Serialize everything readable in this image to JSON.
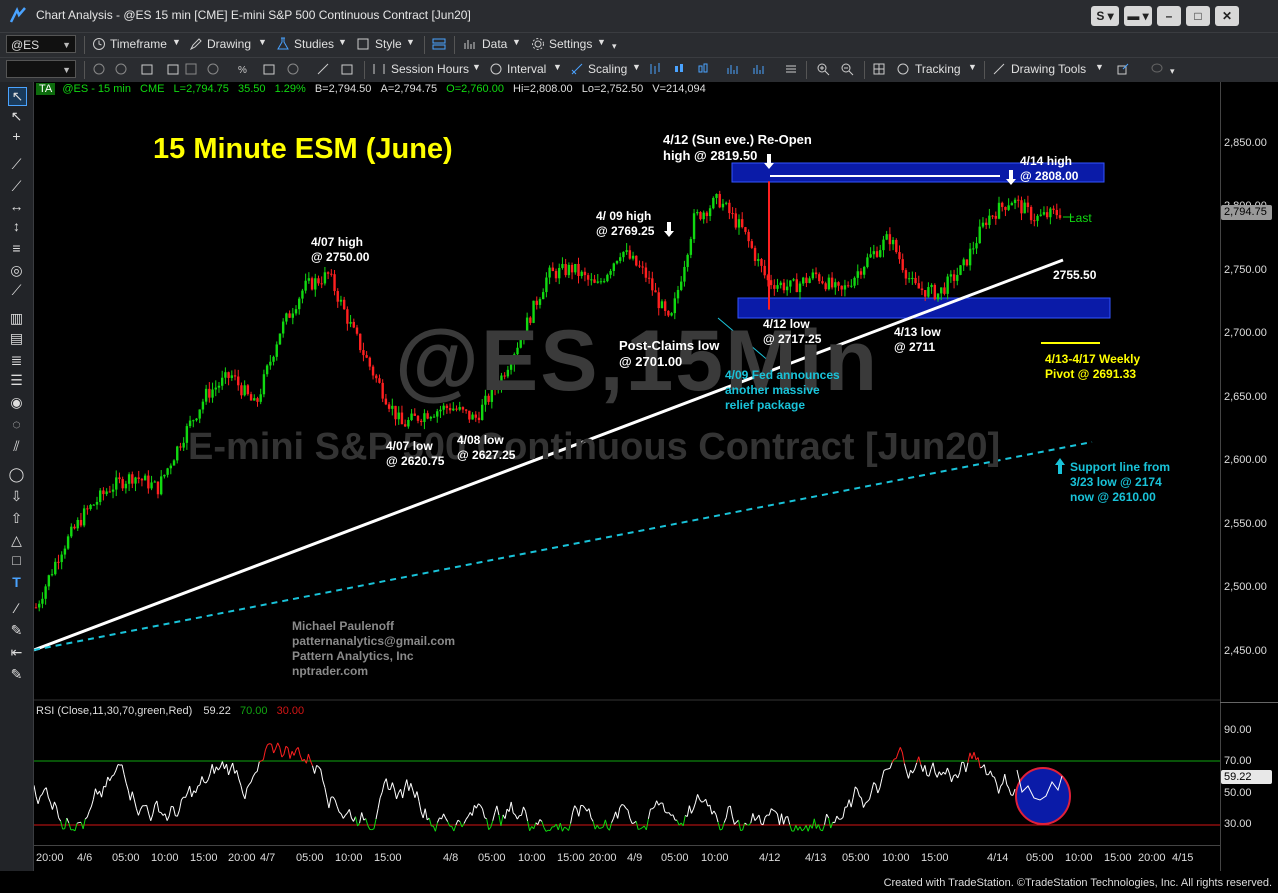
{
  "window": {
    "title": "Chart Analysis - @ES 15 min [CME] E-mini S&P 500 Continuous Contract [Jun20]",
    "btn_s": "S",
    "btn_min": "–",
    "btn_max": "□",
    "btn_close": "✕"
  },
  "toolbar1": {
    "symbol": "@ES",
    "timeframe": "Timeframe",
    "drawing": "Drawing",
    "studies": "Studies",
    "style": "Style",
    "data": "Data",
    "settings": "Settings"
  },
  "toolbar2": {
    "session_hours": "Session Hours",
    "interval": "Interval",
    "scaling": "Scaling",
    "tracking": "Tracking",
    "drawing_tools": "Drawing Tools"
  },
  "legend": {
    "ta": "TA",
    "symbol": "@ES - 15 min",
    "exchange": "CME",
    "last": "L=2,794.75",
    "change": "35.50",
    "pct": "1.29%",
    "bid": "B=2,794.50",
    "ask": "A=2,794.75",
    "open": "O=2,760.00",
    "high": "Hi=2,808.00",
    "low": "Lo=2,752.50",
    "volume": "V=214,094"
  },
  "watermark": {
    "symbol": "@ES,15Min",
    "name": "E-mini S&P 500 Continuous Contract [Jun20]"
  },
  "annotations": {
    "title": "15 Minute ESM (June)",
    "h0407_a": "4/07 high",
    "h0407_b": "@ 2750.00",
    "l0407_a": "4/07 low",
    "l0407_b": "@ 2620.75",
    "l0408_a": "4/08 low",
    "l0408_b": "@ 2627.25",
    "h0409_a": "4/ 09 high",
    "h0409_b": "@ 2769.25",
    "reopen_a": "4/12 (Sun eve.) Re-Open",
    "reopen_b": "high @ 2819.50",
    "h0414_a": "4/14 high",
    "h0414_b": "@ 2808.00",
    "pcl_a": "Post-Claims low",
    "pcl_b": "@ 2701.00",
    "l0412_a": "4/12 low",
    "l0412_b": "@ 2717.25",
    "l0413_a": "4/13 low",
    "l0413_b": "@ 2711",
    "fed_a": "4/09 Fed announces",
    "fed_b": "another massive",
    "fed_c": "relief package",
    "trend_val": "2755.50",
    "pivot_a": "4/13-4/17 Weekly",
    "pivot_b": "Pivot @ 2691.33",
    "support_a": "Support line from",
    "support_b": "3/23 low @ 2174",
    "support_c": "now @ 2610.00",
    "last_label": "Last",
    "author_a": "Michael Paulenoff",
    "author_b": "patternanalytics@gmail.com",
    "author_c": "Pattern Analytics, Inc",
    "author_d": "nptrader.com"
  },
  "price_axis": {
    "labels": [
      "2,850.00",
      "2,800.00",
      "2,750.00",
      "2,700.00",
      "2,650.00",
      "2,600.00",
      "2,550.00",
      "2,500.00",
      "2,450.00"
    ],
    "last_price": "2,794.75"
  },
  "rsi": {
    "label": "RSI (Close,11,30,70,green,Red)",
    "value": "59.22",
    "ob": "70.00",
    "os": "30.00",
    "axis_labels": [
      "90.00",
      "70.00",
      "50.00",
      "30.00"
    ],
    "current": "59.22"
  },
  "time_axis": {
    "labels": [
      "20:00",
      "4/6",
      "05:00",
      "10:00",
      "15:00",
      "20:00",
      "4/7",
      "05:00",
      "10:00",
      "15:00",
      "4/8",
      "05:00",
      "10:00",
      "15:00",
      "20:00",
      "4/9",
      "05:00",
      "10:00",
      "4/12",
      "4/13",
      "05:00",
      "10:00",
      "15:00",
      "4/14",
      "05:00",
      "10:00",
      "15:00",
      "20:00",
      "4/15"
    ]
  },
  "footer": {
    "credit": "Created with TradeStation. ©TradeStation Technologies, Inc. All rights reserved."
  },
  "chart_data": {
    "type": "candlestick",
    "symbol": "@ES",
    "interval": "15 min",
    "ylim": [
      2440,
      2880
    ],
    "levels": {
      "reopen_high": 2819.5,
      "high_0414": 2808.0,
      "last": 2794.75,
      "high_0409": 2769.25,
      "trendline_now": 2755.5,
      "high_0407": 2750.0,
      "low_0412": 2717.25,
      "low_0413": 2711.0,
      "post_claims_low": 2701.0,
      "weekly_pivot": 2691.33,
      "low_0408": 2627.25,
      "low_0407": 2620.75,
      "support_now": 2610.0,
      "support_origin_0323": 2174
    },
    "path_close_estimates": [
      2480,
      2525,
      2555,
      2575,
      2585,
      2575,
      2615,
      2650,
      2665,
      2640,
      2700,
      2735,
      2745,
      2700,
      2660,
      2625,
      2635,
      2640,
      2630,
      2660,
      2700,
      2745,
      2750,
      2735,
      2765,
      2745,
      2705,
      2790,
      2805,
      2780,
      2740,
      2735,
      2745,
      2730,
      2755,
      2775,
      2735,
      2730,
      2750,
      2790,
      2805,
      2790,
      2794.75
    ],
    "rsi": {
      "current": 59.22,
      "overbought": 70,
      "oversold": 30,
      "ylim": [
        20,
        100
      ]
    }
  }
}
